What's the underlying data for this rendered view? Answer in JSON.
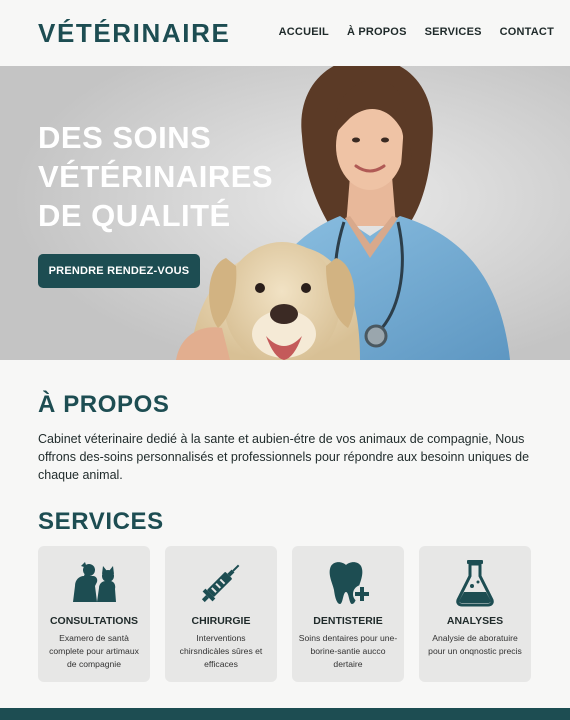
{
  "header": {
    "logo": "VÉTÉRINAIRE",
    "nav": [
      "ACCUEIL",
      "À PROPOS",
      "SERVICES",
      "CONTACT"
    ]
  },
  "hero": {
    "title": "DES SOINS\nVÉTÉRINAIRES\nDE QUALITÉ",
    "button": "PRENDRE RENDEZ-VOUS"
  },
  "about": {
    "title": "À PROPOS",
    "text": "Cabinet véterinaire dedié à la sante et aubien-étre de vos animaux de compagnie, Nous offrons des-soins personnalisés et professionnels pour répondre aux besoinn uniques de chaque animal."
  },
  "services": {
    "title": "SERVICES",
    "items": [
      {
        "title": "CONSULTATIONS",
        "desc": "Examero de santà complete pour artimaux de compagnie",
        "icon": "pets-icon"
      },
      {
        "title": "CHIRURGIE",
        "desc": "Interventions chirsndicàles sûres et efficaces",
        "icon": "syringe-icon"
      },
      {
        "title": "DENTISTERIE",
        "desc": "Soins dentaires pour une-borine-santie aucco dertaire",
        "icon": "tooth-icon"
      },
      {
        "title": "ANALYSES",
        "desc": "Analysie de aboratuire pour un onqnostic precis",
        "icon": "flask-icon"
      }
    ]
  },
  "colors": {
    "brand": "#1d4d52",
    "background": "#f7f7f6",
    "card": "#e7e7e6",
    "scrubs": "#7fb3d8"
  }
}
